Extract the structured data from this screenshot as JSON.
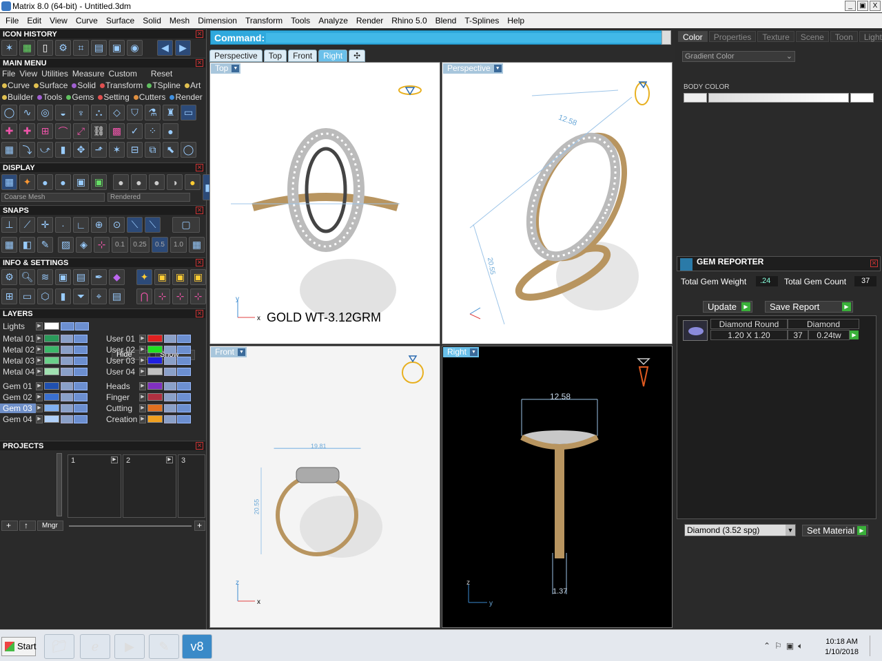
{
  "window": {
    "title": "Matrix 8.0 (64-bit) - Untitled.3dm",
    "controls": [
      "_",
      "▣",
      "X"
    ]
  },
  "menu": [
    "File",
    "Edit",
    "View",
    "Curve",
    "Surface",
    "Solid",
    "Mesh",
    "Dimension",
    "Transform",
    "Tools",
    "Analyze",
    "Render",
    "Rhino 5.0",
    "Blend",
    "T-Splines",
    "Help"
  ],
  "left": {
    "icon_history": "ICON HISTORY",
    "main_menu": "MAIN MENU",
    "main_menu_row1": [
      "File",
      "View",
      "Utilities",
      "Measure",
      "Custom",
      "Reset"
    ],
    "main_menu_row2": [
      {
        "label": "Curve",
        "color": "#e0c050"
      },
      {
        "label": "Surface",
        "color": "#e0c050"
      },
      {
        "label": "Solid",
        "color": "#a060d0"
      },
      {
        "label": "Transform",
        "color": "#e05050"
      },
      {
        "label": "TSpline",
        "color": "#60c060"
      },
      {
        "label": "Art",
        "color": "#e0c050"
      }
    ],
    "main_menu_row3": [
      {
        "label": "Builder",
        "color": "#e0c050"
      },
      {
        "label": "Tools",
        "color": "#a060d0"
      },
      {
        "label": "Gems",
        "color": "#60c060"
      },
      {
        "label": "Setting",
        "color": "#e05050"
      },
      {
        "label": "Cutters",
        "color": "#e09040"
      },
      {
        "label": "Render",
        "color": "#4090e0"
      }
    ],
    "display": "DISPLAY",
    "display_mode": "Coarse Mesh",
    "render_mode": "Rendered",
    "snaps": "SNAPS",
    "snap_values": [
      "0.1",
      "0.25",
      "0.5",
      "1.0"
    ],
    "info": "INFO & SETTINGS",
    "layers": "LAYERS",
    "lights": "Lights",
    "hide": "Hide",
    "show": "Show",
    "layers_left": [
      {
        "name": "Metal 01",
        "color": "#2a9a5a"
      },
      {
        "name": "Metal 02",
        "color": "#3cb86a"
      },
      {
        "name": "Metal 03",
        "color": "#6ad08a"
      },
      {
        "name": "Metal 04",
        "color": "#a0e0b0"
      },
      {
        "name": "Gem 01",
        "color": "#2050b0"
      },
      {
        "name": "Gem 02",
        "color": "#3a70d0"
      },
      {
        "name": "Gem 03",
        "color": "#80b0f0"
      },
      {
        "name": "Gem 04",
        "color": "#b0d0f8"
      }
    ],
    "layers_right": [
      {
        "name": "User 01",
        "color": "#e02020"
      },
      {
        "name": "User 02",
        "color": "#20e020"
      },
      {
        "name": "User 03",
        "color": "#2020e0"
      },
      {
        "name": "User 04",
        "color": "#c0c0c0"
      },
      {
        "name": "Heads",
        "color": "#8030c0"
      },
      {
        "name": "Finger",
        "color": "#b03040"
      },
      {
        "name": "Cutting",
        "color": "#e07020"
      },
      {
        "name": "Creation",
        "color": "#f0a020"
      }
    ],
    "projects": "PROJECTS",
    "project_slots": [
      "1",
      "2",
      "3"
    ],
    "mngr": "Mngr"
  },
  "command": {
    "label": "Command:",
    "value": ""
  },
  "view_tabs": [
    "Perspective",
    "Top",
    "Front",
    "Right"
  ],
  "active_tab": "Right",
  "viewports": {
    "top": {
      "label": "Top",
      "annotation": "GOLD WT-3.12GRM"
    },
    "perspective": {
      "label": "Perspective",
      "dim_width": "12.58",
      "dim_height": "20.55"
    },
    "front": {
      "label": "Front",
      "dim_width": "19.81",
      "dim_height": "20.55"
    },
    "right": {
      "label": "Right",
      "dim_width": "12.58",
      "dim_band": "1.37"
    }
  },
  "right": {
    "tabs": [
      "Color",
      "Properties",
      "Texture",
      "Scene",
      "Toon",
      "Light"
    ],
    "gradient": "Gradient Color",
    "body_color": "BODY COLOR",
    "gem_reporter": "GEM REPORTER",
    "total_weight_label": "Total Gem Weight",
    "total_weight": ".24",
    "total_count_label": "Total Gem Count",
    "total_count": "37",
    "update": "Update",
    "save_report": "Save Report",
    "gem_row": {
      "type": "Diamond Round",
      "material": "Diamond",
      "size": "1.20 X 1.20",
      "count": "37",
      "weight": "0.24tw"
    },
    "material_select": "Diamond    (3.52 spg)",
    "set_material": "Set Material"
  },
  "taskbar": {
    "start": "Start",
    "time": "10:18 AM",
    "date": "1/10/2018"
  }
}
